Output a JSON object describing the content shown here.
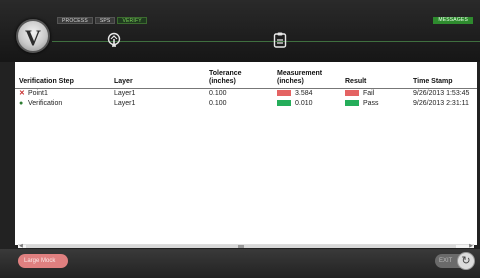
{
  "nav": {
    "tabs": [
      {
        "label": "PROCESS"
      },
      {
        "label": "SPS"
      },
      {
        "label": "VERIFY"
      }
    ],
    "messages_label": "MESSAGES"
  },
  "icons": {
    "logo": "v-logo",
    "wrench": "wrench-gauge-icon",
    "clipboard": "clipboard-icon",
    "refresh": "refresh-icon"
  },
  "colors": {
    "fail": "#e46363",
    "pass": "#25ad5a",
    "active_tab": "#7ed35a"
  },
  "table": {
    "headers": {
      "step": "Verification Step",
      "layer": "Layer",
      "tolerance": "Tolerance (inches)",
      "measurement": "Measurement (inches)",
      "result": "Result",
      "timestamp": "Time Stamp"
    },
    "rows": [
      {
        "status": "fail",
        "step": "Point1",
        "layer": "Layer1",
        "tolerance": "0.100",
        "measurement": "3.584",
        "result": "Fail",
        "timestamp": "9/26/2013 1:53:45"
      },
      {
        "status": "pass",
        "step": "Verification",
        "layer": "Layer1",
        "tolerance": "0.100",
        "measurement": "0.010",
        "result": "Pass",
        "timestamp": "9/26/2013 2:31:11"
      }
    ]
  },
  "footer": {
    "left_button": "Large Mock",
    "right_button": "EXIT"
  }
}
